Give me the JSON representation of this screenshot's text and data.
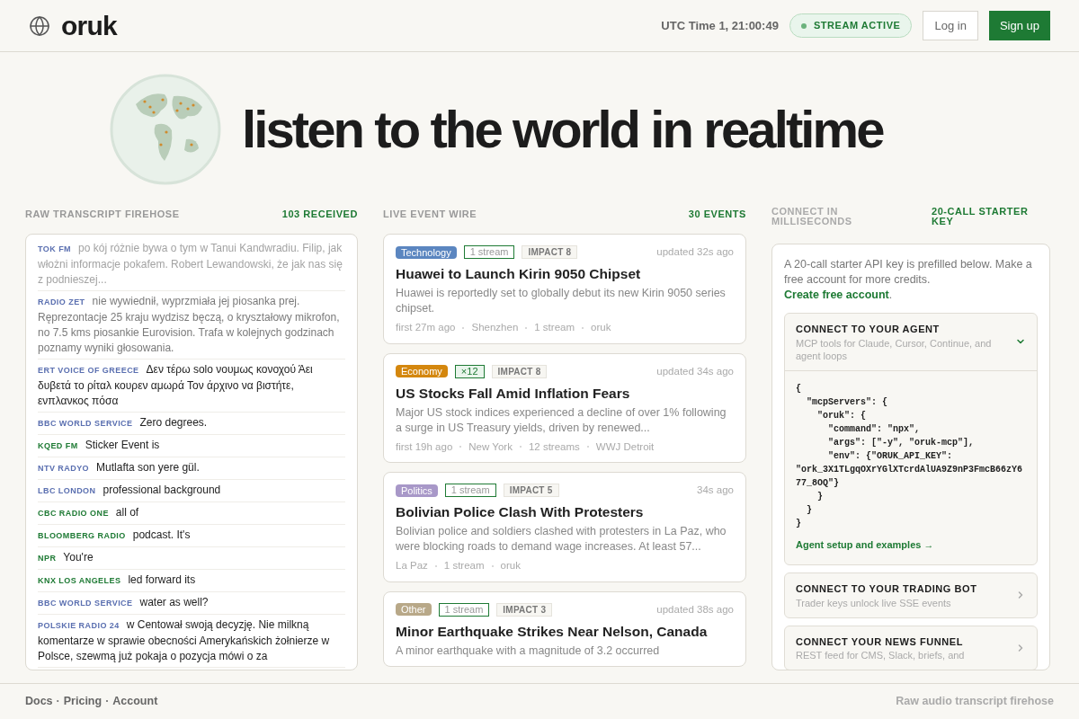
{
  "header": {
    "logo": "oruk",
    "time": "UTC Time 1, 21:00:49",
    "stream_status": {
      "label": "STREAM ACTIVE",
      "on": true
    },
    "login": "Log in",
    "signup": "Sign up"
  },
  "hero": {
    "title": "listen to the world in realtime"
  },
  "firehose": {
    "title": "RAW TRANSCRIPT FIREHOSE",
    "count": "103 RECEIVED",
    "entries": [
      {
        "station": "TOK FM",
        "text": "po kój różnie bywa o tym w Tanui Kandwradiu. Filip, jak włożni informacje pokafem. Robert Lewandowski, że jak nas się z podnieszej...",
        "color": "#5a6fb0",
        "kind": "faded"
      },
      {
        "station": "RADIO ZET",
        "text": "nie wywiednił, wyprzmiała jej piosanka prej. Ręprezontacje 25 kraju wydzisz bęczą, o kryształowy mikrofon, no 7.5 kms piosankie Eurovision. Trafa w kolejnych godzinach poznamy wyniki głosowania.",
        "color": "#5a6fb0",
        "kind": "dim"
      },
      {
        "station": "ERT VOICE OF GREECE",
        "text": "Δεν τέρω solo νουμως κονοχού Άει δυβετά το ρίταλ κουρεν αμωρά Τον άρχινο να βιστήτε, ενπλανκος πόσα",
        "color": "#5a6fb0",
        "kind": "normal"
      },
      {
        "station": "BBC WORLD SERVICE",
        "text": "Zero degrees.",
        "color": "#5a6fb0",
        "kind": "normal"
      },
      {
        "station": "KQED FM",
        "text": "Sticker Event is",
        "color": "#1e7a34",
        "kind": "normal"
      },
      {
        "station": "NTV RADYO",
        "text": "Mutlafta son yere gül.",
        "color": "#5a6fb0",
        "kind": "normal"
      },
      {
        "station": "LBC LONDON",
        "text": "professional background",
        "color": "#5a6fb0",
        "kind": "normal"
      },
      {
        "station": "CBC RADIO ONE",
        "text": "all of",
        "color": "#1e7a34",
        "kind": "normal"
      },
      {
        "station": "BLOOMBERG RADIO",
        "text": "podcast. It's",
        "color": "#1e7a34",
        "kind": "normal"
      },
      {
        "station": "NPR",
        "text": "You're",
        "color": "#1e7a34",
        "kind": "normal"
      },
      {
        "station": "KNX LOS ANGELES",
        "text": "led forward its",
        "color": "#1e7a34",
        "kind": "normal"
      },
      {
        "station": "BBC WORLD SERVICE",
        "text": "water as well?",
        "color": "#5a6fb0",
        "kind": "normal"
      },
      {
        "station": "POLSKIE RADIO 24",
        "text": "w Centował swoją decyzję. Nie milkną komentarze w sprawie obecności Amerykańskich żołnierze w Polsce, szewmą już pokaja o pozycja mówi o za",
        "color": "#5a6fb0",
        "kind": "normal"
      }
    ]
  },
  "wire": {
    "title": "LIVE EVENT WIRE",
    "count": "30 EVENTS",
    "events": [
      {
        "category": "Technology",
        "color": "#5b86c0",
        "streams": "1 stream",
        "highlighted": false,
        "impact": "IMPACT 8",
        "updated": "updated 32s ago",
        "title": "Huawei to Launch Kirin 9050 Chipset",
        "summary": "Huawei is reportedly set to globally debut its new Kirin 9050 series chipset.",
        "meta": [
          "first 27m ago",
          "Shenzhen",
          "1 stream",
          "oruk"
        ]
      },
      {
        "category": "Economy",
        "color": "#d4870e",
        "streams": "×12",
        "highlighted": true,
        "impact": "IMPACT 8",
        "updated": "updated 34s ago",
        "title": "US Stocks Fall Amid Inflation Fears",
        "summary": "Major US stock indices experienced a decline of over 1% following a surge in US Treasury yields, driven by renewed...",
        "meta": [
          "first 19h ago",
          "New York",
          "12 streams",
          "WWJ Detroit"
        ]
      },
      {
        "category": "Politics",
        "color": "#a898c8",
        "streams": "1 stream",
        "highlighted": false,
        "impact": "IMPACT 5",
        "updated": "34s ago",
        "title": "Bolivian Police Clash With Protesters",
        "summary": "Bolivian police and soldiers clashed with protesters in La Paz, who were blocking roads to demand wage increases. At least 57...",
        "meta": [
          "La Paz",
          "1 stream",
          "oruk"
        ]
      },
      {
        "category": "Other",
        "color": "#b8a888",
        "streams": "1 stream",
        "highlighted": false,
        "impact": "IMPACT 3",
        "updated": "updated 38s ago",
        "title": "Minor Earthquake Strikes Near Nelson, Canada",
        "summary": "A minor earthquake with a magnitude of 3.2 occurred"
      }
    ]
  },
  "connect": {
    "title": "CONNECT IN MILLISECONDS",
    "badge": "20-CALL STARTER KEY",
    "intro": "A 20-call starter API key is prefilled below. Make a free account for more credits.",
    "intro_link": "Create free account",
    "intro_end": ".",
    "sections": [
      {
        "title": "CONNECT TO YOUR AGENT",
        "subtitle": "MCP tools for Claude, Cursor, Continue, and agent loops",
        "expanded": true,
        "code": "{\n  \"mcpServers\": {\n    \"oruk\": {\n      \"command\": \"npx\",\n      \"args\": [\"-y\", \"oruk-mcp\"],\n      \"env\": {\"ORUK_API_KEY\":\n\"ork_3X1TLgqOXrYGlXTcrdAlUA9Z9nP3FmcB66zY677_8OQ\"}\n    }\n  }\n}",
        "link": "Agent setup and examples →"
      },
      {
        "title": "CONNECT TO YOUR TRADING BOT",
        "subtitle": "Trader keys unlock live SSE events",
        "expanded": false
      },
      {
        "title": "CONNECT YOUR NEWS FUNNEL",
        "subtitle": "REST feed for CMS, Slack, briefs, and",
        "expanded": false
      }
    ]
  },
  "footer": {
    "links": [
      "Docs",
      "Pricing",
      "Account"
    ],
    "separator": "·",
    "tagline": "Raw audio transcript firehose"
  }
}
